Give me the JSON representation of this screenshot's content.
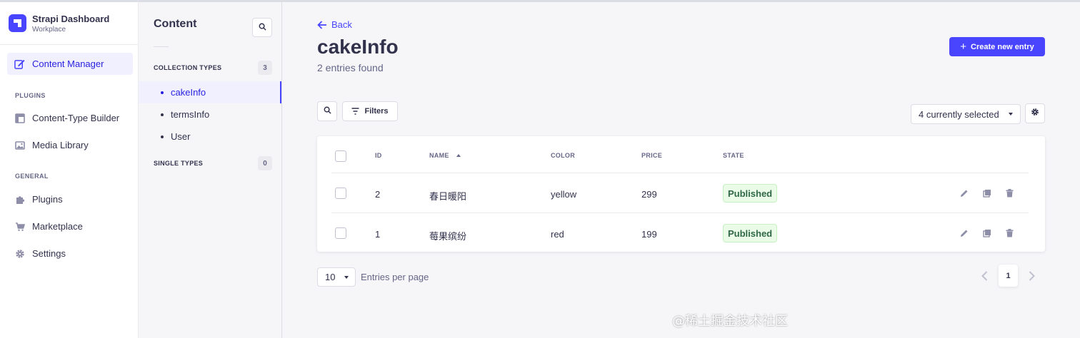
{
  "brand": {
    "title": "Strapi Dashboard",
    "subtitle": "Workplace"
  },
  "mainnav": {
    "content_manager": "Content Manager",
    "plugins_section": "PLUGINS",
    "plugin_items": [
      "Content-Type Builder",
      "Media Library"
    ],
    "general_section": "GENERAL",
    "general_items": [
      "Plugins",
      "Marketplace",
      "Settings"
    ]
  },
  "subnav": {
    "title": "Content",
    "collection_label": "COLLECTION TYPES",
    "collection_count": "3",
    "collection_items": [
      "cakeInfo",
      "termsInfo",
      "User"
    ],
    "single_label": "SINGLE TYPES",
    "single_count": "0"
  },
  "header": {
    "back": "Back",
    "title": "cakeInfo",
    "subtitle": "2 entries found",
    "create_button": "Create new entry"
  },
  "toolbar": {
    "filters": "Filters",
    "columns_select": "4 currently selected"
  },
  "table": {
    "headers": [
      "ID",
      "NAME",
      "COLOR",
      "PRICE",
      "STATE"
    ],
    "rows": [
      {
        "id": "2",
        "name": "春日暖阳",
        "color": "yellow",
        "price": "299",
        "state": "Published"
      },
      {
        "id": "1",
        "name": "莓果缤纷",
        "color": "red",
        "price": "199",
        "state": "Published"
      }
    ]
  },
  "pagination": {
    "page_size": "10",
    "page_size_label": "Entries per page",
    "current_page": "1"
  },
  "watermark": "@稀土掘金技术社区",
  "colors": {
    "accent": "#4945ff",
    "badge_bg": "#eafbe7",
    "badge_text": "#2f6846"
  }
}
